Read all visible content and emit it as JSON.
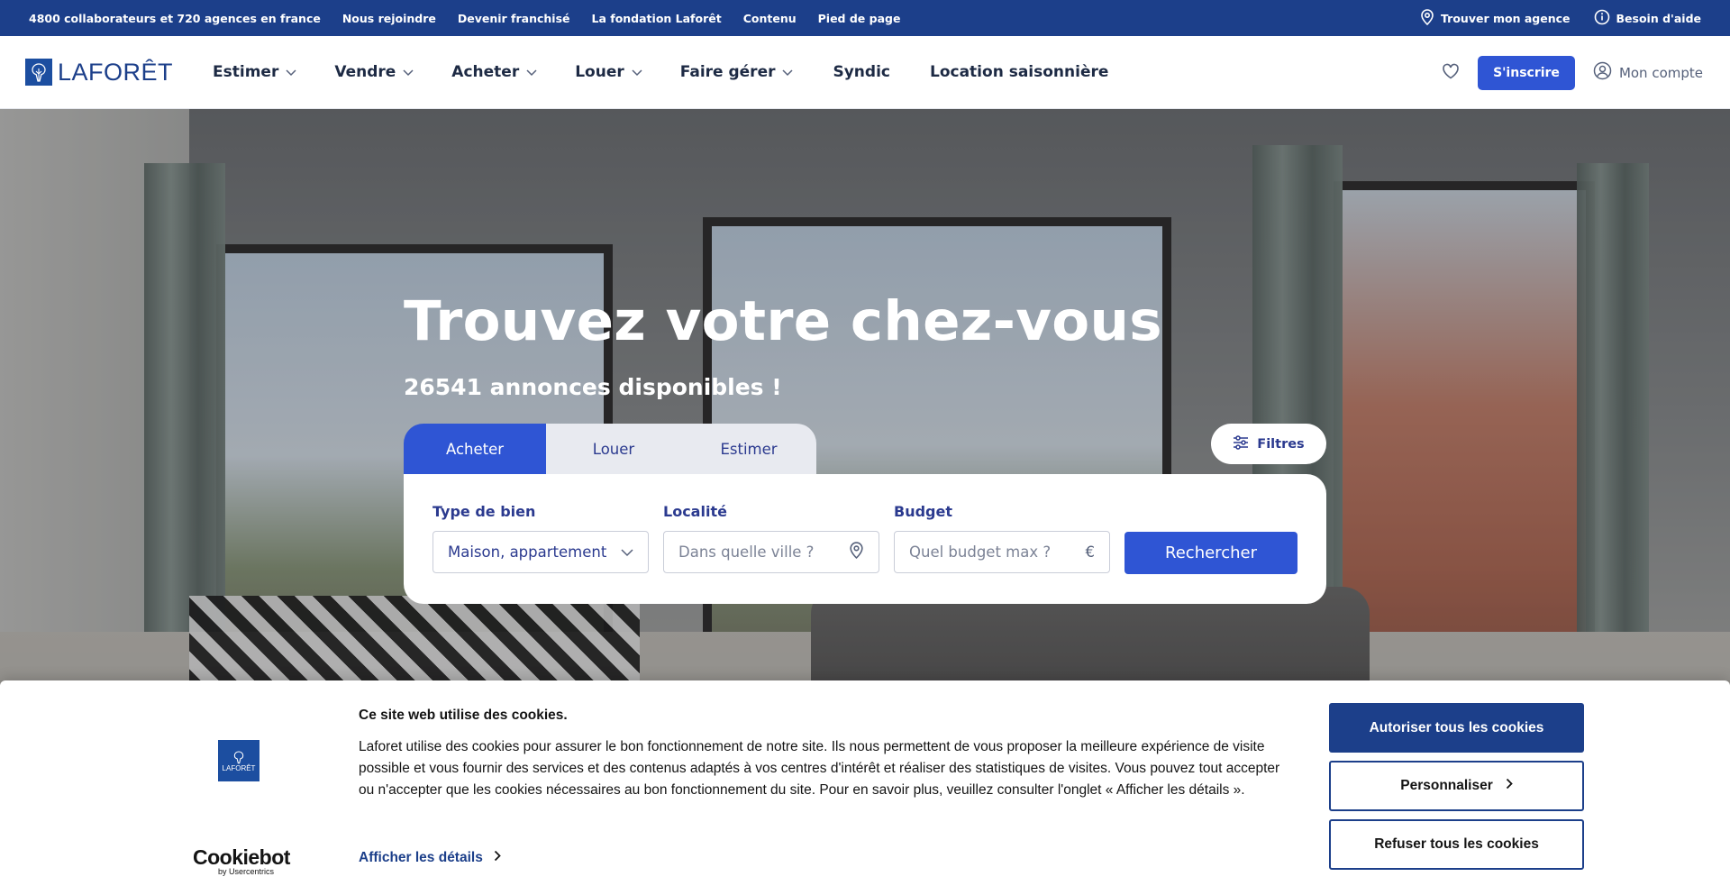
{
  "topbar": {
    "links": [
      {
        "label": "4800 collaborateurs et 720 agences en france"
      },
      {
        "label": "Nous rejoindre"
      },
      {
        "label": "Devenir franchisé"
      },
      {
        "label": "La fondation Laforêt"
      },
      {
        "label": "Contenu"
      },
      {
        "label": "Pied de page"
      }
    ],
    "find_agency": "Trouver mon agence",
    "help": "Besoin d'aide"
  },
  "nav": {
    "logo_text": "LAFORÊT",
    "items": [
      {
        "label": "Estimer"
      },
      {
        "label": "Vendre"
      },
      {
        "label": "Acheter"
      },
      {
        "label": "Louer"
      },
      {
        "label": "Faire gérer"
      },
      {
        "label": "Syndic"
      },
      {
        "label": "Location saisonnière"
      }
    ],
    "signup": "S'inscrire",
    "account": "Mon compte"
  },
  "hero": {
    "title": "Trouvez votre chez-vous",
    "subtitle": "26541 annonces disponibles !"
  },
  "search": {
    "tabs": [
      {
        "label": "Acheter"
      },
      {
        "label": "Louer"
      },
      {
        "label": "Estimer"
      }
    ],
    "filters": "Filtres",
    "type_label": "Type de bien",
    "type_value": "Maison, appartement",
    "location_label": "Localité",
    "location_placeholder": "Dans quelle ville ?",
    "budget_label": "Budget",
    "budget_placeholder": "Quel budget max ?",
    "budget_currency": "€",
    "submit": "Rechercher"
  },
  "cookie": {
    "logo_text": "LAFORÊT",
    "title": "Ce site web utilise des cookies.",
    "body": "Laforet utilise des cookies pour assurer le bon fonctionnement de notre site. Ils nous permettent de vous proposer la meilleure expérience de visite possible et vous fournir des services et des contenus adaptés à vos centres d'intérêt et réaliser des statistiques de visites. Vous pouvez tout accepter ou n'accepter que les cookies nécessaires au bon fonctionnement du site. Pour en savoir plus, veuillez consulter l'onglet « Afficher les détails ».",
    "details": "Afficher les détails",
    "allow": "Autoriser tous les cookies",
    "customize": "Personnaliser",
    "refuse": "Refuser tous les cookies",
    "brand": "Cookiebot",
    "brand_by": "by Usercentrics"
  },
  "colors": {
    "brand_blue": "#1c3f8a",
    "accent_blue": "#2f55d4"
  },
  "icons": [
    "location-pin-icon",
    "info-icon",
    "chevron-down-icon",
    "heart-icon",
    "user-circle-icon",
    "sliders-icon",
    "chevron-right-icon",
    "tree-logo-icon"
  ]
}
